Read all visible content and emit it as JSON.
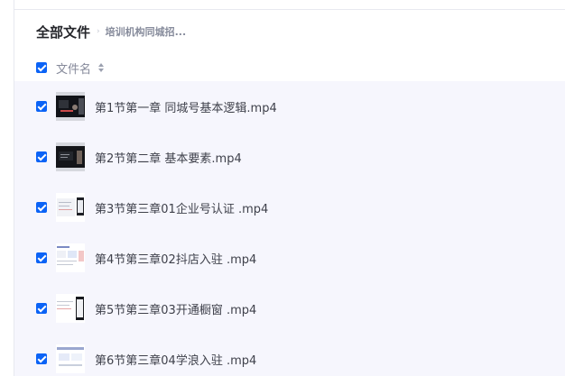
{
  "breadcrumb": {
    "root": "全部文件",
    "separator": "›",
    "current": "培训机构同城招..."
  },
  "list_header": {
    "column_label": "文件名",
    "sort_icon": "sort-up-down-icon"
  },
  "files": [
    {
      "name": "第1节第一章 同城号基本逻辑.mp4",
      "selected": true,
      "thumbnail": "video-thumbnail-dark"
    },
    {
      "name": "第2节第二章 基本要素.mp4",
      "selected": true,
      "thumbnail": "video-thumbnail-dark"
    },
    {
      "name": "第3节第三章01企业号认证 .mp4",
      "selected": true,
      "thumbnail": "video-thumbnail-light"
    },
    {
      "name": "第4节第三章02抖店入驻 .mp4",
      "selected": true,
      "thumbnail": "video-thumbnail-light"
    },
    {
      "name": "第5节第三章03开通橱窗 .mp4",
      "selected": true,
      "thumbnail": "video-thumbnail-light"
    },
    {
      "name": "第6节第三章04学浪入驻 .mp4",
      "selected": true,
      "thumbnail": "video-thumbnail-light"
    }
  ],
  "colors": {
    "checkbox": "#0b63f6",
    "selected_row_background": "#f6f6fd",
    "text": "#3f414b"
  }
}
